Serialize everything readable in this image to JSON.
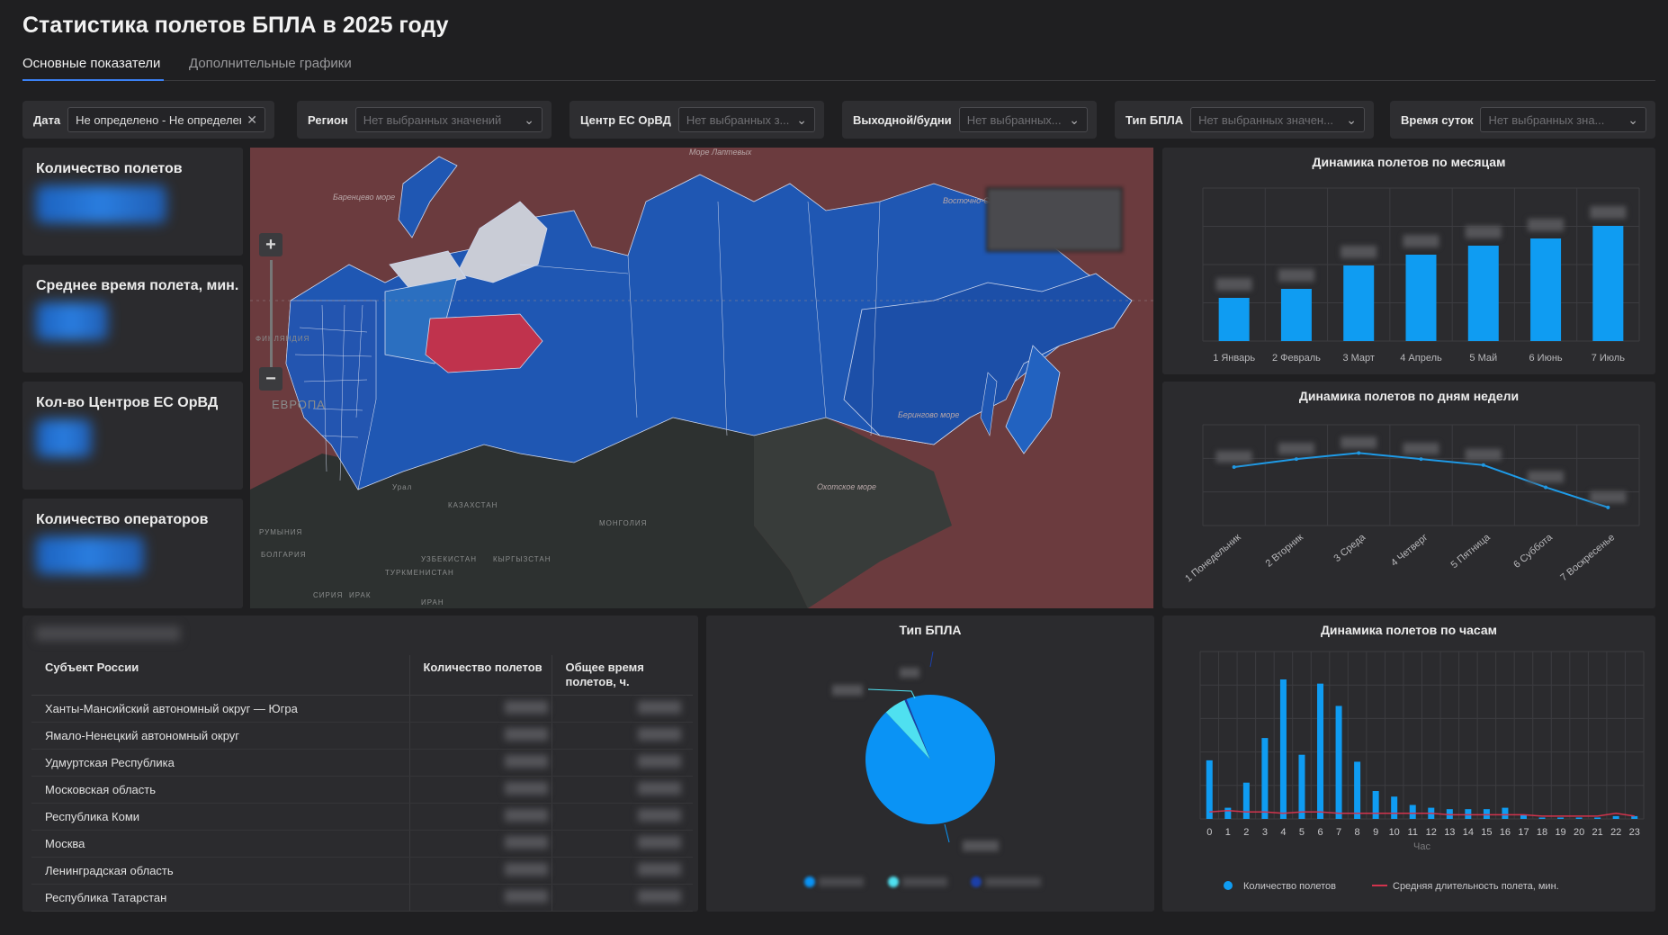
{
  "page_title": "Статистика полетов БПЛА в 2025 году",
  "tabs": [
    {
      "label": "Основные показатели",
      "active": true
    },
    {
      "label": "Дополнительные графики",
      "active": false
    }
  ],
  "filters": [
    {
      "label": "Дата",
      "value": "Не определено - Не определено",
      "set": true,
      "icon": "close-icon"
    },
    {
      "label": "Регион",
      "value": "Нет выбранных значений",
      "set": false,
      "icon": "chevron-down-icon"
    },
    {
      "label": "Центр ЕС ОрВД",
      "value": "Нет выбранных з...",
      "set": false,
      "icon": "chevron-down-icon"
    },
    {
      "label": "Выходной/будни",
      "value": "Нет выбранных...",
      "set": false,
      "icon": "chevron-down-icon"
    },
    {
      "label": "Тип БПЛА",
      "value": "Нет выбранных значен...",
      "set": false,
      "icon": "chevron-down-icon"
    },
    {
      "label": "Время суток",
      "value": "Нет выбранных зна...",
      "set": false,
      "icon": "chevron-down-icon"
    }
  ],
  "kpis": [
    {
      "title": "Количество полетов"
    },
    {
      "title": "Среднее время полета, мин."
    },
    {
      "title": "Кол-во Центров ЕС ОрВД"
    },
    {
      "title": "Количество операторов"
    }
  ],
  "map": {
    "labels": [
      "Море Лаптевых",
      "Баренцево море",
      "Берингово море",
      "Охотское море",
      "КАЗАХСТАН",
      "МОНГОЛИЯ",
      "УЗБЕКИСТАН",
      "КЫРГЫЗСТАН",
      "ТУРКМЕНИСТАН",
      "ИРАН",
      "СИРИЯ",
      "ИРАК",
      "РУМЫНИЯ",
      "БОЛГАРИЯ",
      "ФИНЛЯНДИЯ",
      "ЕВРОПА",
      "Урал",
      "Восточно-Сибирское море"
    ],
    "zoom_in": "+",
    "zoom_out": "−"
  },
  "monthly": {
    "title": "Динамика полетов по месяцам",
    "chart_data": {
      "type": "bar",
      "categories": [
        "1 Январь",
        "2 Февраль",
        "3 Март",
        "4 Апрель",
        "5 Май",
        "6 Июнь",
        "7 Июль"
      ],
      "values": [
        24,
        29,
        42,
        48,
        53,
        57,
        64
      ],
      "ylim": [
        0,
        85
      ],
      "grid": true,
      "color": "#0f9cf2"
    }
  },
  "weekday": {
    "title": "Динамика полетов по дням недели",
    "chart_data": {
      "type": "line",
      "categories": [
        "1 Понедельник",
        "2 Вторник",
        "3 Среда",
        "4 Четверг",
        "5 Пятница",
        "6 Суббота",
        "7 Воскресенье"
      ],
      "values": [
        58,
        66,
        72,
        66,
        60,
        38,
        18
      ],
      "ylim": [
        0,
        100
      ],
      "grid": true,
      "color": "#1e9be8"
    }
  },
  "hourly": {
    "title": "Динамика полетов по часам",
    "xlabel": "Час",
    "chart_data": {
      "type": "bar",
      "categories": [
        "0",
        "1",
        "2",
        "3",
        "4",
        "5",
        "6",
        "7",
        "8",
        "9",
        "10",
        "11",
        "12",
        "13",
        "14",
        "15",
        "16",
        "17",
        "18",
        "19",
        "20",
        "21",
        "22",
        "23"
      ],
      "series": [
        {
          "name": "Количество полетов",
          "type": "bar",
          "color": "#0f9cf2",
          "values": [
            42,
            8,
            26,
            58,
            100,
            46,
            97,
            81,
            41,
            20,
            16,
            10,
            8,
            7,
            7,
            7,
            8,
            3,
            1,
            1,
            1,
            1,
            2,
            2
          ]
        },
        {
          "name": "Средняя длительность полета, мин.",
          "type": "line",
          "color": "#d2334d",
          "values": [
            5,
            6,
            5,
            5,
            4,
            5,
            5,
            4,
            4,
            4,
            4,
            4,
            4,
            3,
            3,
            3,
            3,
            3,
            2,
            2,
            2,
            2,
            4,
            2
          ]
        }
      ],
      "ylim": [
        0,
        120
      ],
      "legend": "bottom"
    }
  },
  "uav_type": {
    "title": "Тип БПЛА",
    "chart_data": {
      "type": "pie",
      "values": [
        94,
        5.5,
        0.5
      ],
      "colors": [
        "#0a93f5",
        "#4fe0f0",
        "#1c3fa8"
      ]
    }
  },
  "regions_table": {
    "columns": [
      "Субъект России",
      "Количество полетов",
      "Общее время полетов, ч."
    ],
    "rows": [
      "Ханты-Мансийский автономный округ — Югра",
      "Ямало-Ненецкий автономный округ",
      "Удмуртская Республика",
      "Московская область",
      "Республика Коми",
      "Москва",
      "Ленинградская область",
      "Республика Татарстан"
    ]
  }
}
